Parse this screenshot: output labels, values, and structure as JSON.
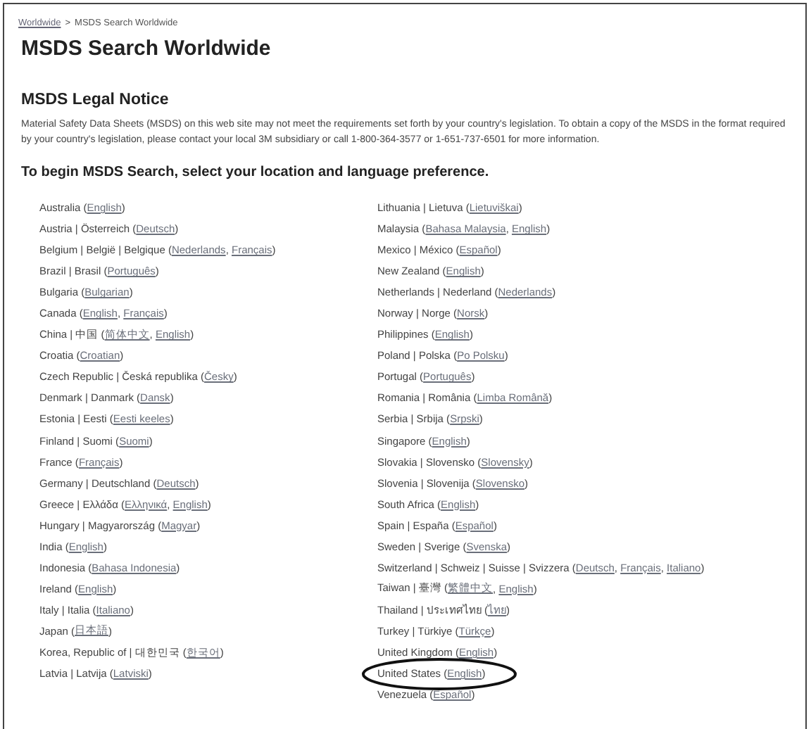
{
  "breadcrumb": {
    "link": "Worldwide",
    "separator": ">",
    "current": "MSDS Search Worldwide"
  },
  "title": "MSDS Search Worldwide",
  "notice": {
    "heading": "MSDS Legal Notice",
    "text": "Material Safety Data Sheets (MSDS) on this web site may not meet the requirements set forth by your country's legislation. To obtain a copy of the MSDS in the format required by your country's legislation, please contact your local 3M subsidiary or call 1-800-364-3577 or 1-651-737-6501 for more information."
  },
  "prompt": "To begin MSDS Search, select your location and language preference.",
  "columns": [
    [
      {
        "highlighted": false,
        "parts": [
          {
            "text": "Australia ("
          },
          {
            "link": "English"
          },
          {
            "text": ")"
          }
        ]
      },
      {
        "highlighted": false,
        "parts": [
          {
            "text": "Austria | Österreich ("
          },
          {
            "link": "Deutsch"
          },
          {
            "text": ")"
          }
        ]
      },
      {
        "highlighted": false,
        "parts": [
          {
            "text": "Belgium | België | Belgique ("
          },
          {
            "link": "Nederlands"
          },
          {
            "text": ", "
          },
          {
            "link": "Français"
          },
          {
            "text": ")"
          }
        ]
      },
      {
        "highlighted": false,
        "parts": [
          {
            "text": "Brazil | Brasil ("
          },
          {
            "link": "Português"
          },
          {
            "text": ")"
          }
        ]
      },
      {
        "highlighted": false,
        "parts": [
          {
            "text": "Bulgaria ("
          },
          {
            "link": "Bulgarian"
          },
          {
            "text": ")"
          }
        ]
      },
      {
        "highlighted": false,
        "parts": [
          {
            "text": "Canada ("
          },
          {
            "link": "English"
          },
          {
            "text": ", "
          },
          {
            "link": "Français"
          },
          {
            "text": ")"
          }
        ]
      },
      {
        "highlighted": false,
        "parts": [
          {
            "text": "China | 中国 ("
          },
          {
            "link": "简体中文"
          },
          {
            "text": ", "
          },
          {
            "link": "English"
          },
          {
            "text": ")"
          }
        ]
      },
      {
        "highlighted": false,
        "parts": [
          {
            "text": "Croatia ("
          },
          {
            "link": "Croatian"
          },
          {
            "text": ")"
          }
        ]
      },
      {
        "highlighted": false,
        "parts": [
          {
            "text": "Czech Republic | Česká republika ("
          },
          {
            "link": "Česky"
          },
          {
            "text": ")"
          }
        ]
      },
      {
        "highlighted": false,
        "parts": [
          {
            "text": "Denmark | Danmark ("
          },
          {
            "link": "Dansk"
          },
          {
            "text": ")"
          }
        ]
      },
      {
        "highlighted": false,
        "parts": [
          {
            "text": "Estonia | Eesti ("
          },
          {
            "link": "Eesti keeles"
          },
          {
            "text": ")"
          }
        ]
      },
      {
        "highlighted": false,
        "parts": [
          {
            "text": "Finland | Suomi ("
          },
          {
            "link": "Suomi"
          },
          {
            "text": ")"
          }
        ]
      },
      {
        "highlighted": false,
        "parts": [
          {
            "text": "France ("
          },
          {
            "link": "Français"
          },
          {
            "text": ")"
          }
        ]
      },
      {
        "highlighted": false,
        "parts": [
          {
            "text": "Germany | Deutschland ("
          },
          {
            "link": "Deutsch"
          },
          {
            "text": ")"
          }
        ]
      },
      {
        "highlighted": false,
        "parts": [
          {
            "text": "Greece | Ελλάδα ("
          },
          {
            "link": "Ελληνικά"
          },
          {
            "text": ", "
          },
          {
            "link": "English"
          },
          {
            "text": ")"
          }
        ]
      },
      {
        "highlighted": false,
        "parts": [
          {
            "text": "Hungary | Magyarország ("
          },
          {
            "link": "Magyar"
          },
          {
            "text": ")"
          }
        ]
      },
      {
        "highlighted": false,
        "parts": [
          {
            "text": "India ("
          },
          {
            "link": "English"
          },
          {
            "text": ")"
          }
        ]
      },
      {
        "highlighted": false,
        "parts": [
          {
            "text": "Indonesia ("
          },
          {
            "link": "Bahasa Indonesia"
          },
          {
            "text": ")"
          }
        ]
      },
      {
        "highlighted": false,
        "parts": [
          {
            "text": "Ireland ("
          },
          {
            "link": "English"
          },
          {
            "text": ")"
          }
        ]
      },
      {
        "highlighted": false,
        "parts": [
          {
            "text": "Italy | Italia ("
          },
          {
            "link": "Italiano"
          },
          {
            "text": ")"
          }
        ]
      },
      {
        "highlighted": false,
        "parts": [
          {
            "text": "Japan ("
          },
          {
            "link": "日本語"
          },
          {
            "text": ")"
          }
        ]
      },
      {
        "highlighted": false,
        "parts": [
          {
            "text": "Korea, Republic of | 대한민국 ("
          },
          {
            "link": "한국어"
          },
          {
            "text": ")"
          }
        ]
      },
      {
        "highlighted": false,
        "parts": [
          {
            "text": "Latvia | Latvija ("
          },
          {
            "link": "Latviski"
          },
          {
            "text": ")"
          }
        ]
      }
    ],
    [
      {
        "highlighted": false,
        "parts": [
          {
            "text": "Lithuania | Lietuva ("
          },
          {
            "link": "Lietuviškai"
          },
          {
            "text": ")"
          }
        ]
      },
      {
        "highlighted": false,
        "parts": [
          {
            "text": "Malaysia ("
          },
          {
            "link": "Bahasa Malaysia"
          },
          {
            "text": ", "
          },
          {
            "link": "English"
          },
          {
            "text": ")"
          }
        ]
      },
      {
        "highlighted": false,
        "parts": [
          {
            "text": "Mexico | México ("
          },
          {
            "link": "Español"
          },
          {
            "text": ")"
          }
        ]
      },
      {
        "highlighted": false,
        "parts": [
          {
            "text": "New Zealand ("
          },
          {
            "link": "English"
          },
          {
            "text": ")"
          }
        ]
      },
      {
        "highlighted": false,
        "parts": [
          {
            "text": "Netherlands | Nederland ("
          },
          {
            "link": "Nederlands"
          },
          {
            "text": ")"
          }
        ]
      },
      {
        "highlighted": false,
        "parts": [
          {
            "text": "Norway | Norge ("
          },
          {
            "link": "Norsk"
          },
          {
            "text": ")"
          }
        ]
      },
      {
        "highlighted": false,
        "parts": [
          {
            "text": "Philippines ("
          },
          {
            "link": "English"
          },
          {
            "text": ")"
          }
        ]
      },
      {
        "highlighted": false,
        "parts": [
          {
            "text": "Poland | Polska ("
          },
          {
            "link": "Po Polsku"
          },
          {
            "text": ")"
          }
        ]
      },
      {
        "highlighted": false,
        "parts": [
          {
            "text": "Portugal ("
          },
          {
            "link": "Português"
          },
          {
            "text": ")"
          }
        ]
      },
      {
        "highlighted": false,
        "parts": [
          {
            "text": "Romania | România ("
          },
          {
            "link": "Limba Română"
          },
          {
            "text": ")"
          }
        ]
      },
      {
        "highlighted": false,
        "parts": [
          {
            "text": "Serbia | Srbija ("
          },
          {
            "link": "Srpski"
          },
          {
            "text": ")"
          }
        ]
      },
      {
        "highlighted": false,
        "parts": [
          {
            "text": "Singapore ("
          },
          {
            "link": "English"
          },
          {
            "text": ")"
          }
        ]
      },
      {
        "highlighted": false,
        "parts": [
          {
            "text": "Slovakia | Slovensko ("
          },
          {
            "link": "Slovensky"
          },
          {
            "text": ")"
          }
        ]
      },
      {
        "highlighted": false,
        "parts": [
          {
            "text": "Slovenia | Slovenija ("
          },
          {
            "link": "Slovensko"
          },
          {
            "text": ")"
          }
        ]
      },
      {
        "highlighted": false,
        "parts": [
          {
            "text": "South Africa ("
          },
          {
            "link": "English"
          },
          {
            "text": ")"
          }
        ]
      },
      {
        "highlighted": false,
        "parts": [
          {
            "text": "Spain | España ("
          },
          {
            "link": "Español"
          },
          {
            "text": ")"
          }
        ]
      },
      {
        "highlighted": false,
        "parts": [
          {
            "text": "Sweden | Sverige ("
          },
          {
            "link": "Svenska"
          },
          {
            "text": ")"
          }
        ]
      },
      {
        "highlighted": false,
        "parts": [
          {
            "text": "Switzerland | Schweiz | Suisse | Svizzera ("
          },
          {
            "link": "Deutsch"
          },
          {
            "text": ", "
          },
          {
            "link": "Français"
          },
          {
            "text": ", "
          },
          {
            "link": "Italiano"
          },
          {
            "text": ")"
          }
        ]
      },
      {
        "highlighted": false,
        "parts": [
          {
            "text": "Taiwan | 臺灣 ("
          },
          {
            "link": "繁體中文"
          },
          {
            "text": ", "
          },
          {
            "link": "English"
          },
          {
            "text": ")"
          }
        ]
      },
      {
        "highlighted": false,
        "parts": [
          {
            "text": "Thailand | ประเทศไทย ("
          },
          {
            "link": "ไทย"
          },
          {
            "text": ")"
          }
        ]
      },
      {
        "highlighted": false,
        "parts": [
          {
            "text": "Turkey | Türkiye ("
          },
          {
            "link": "Türkçe"
          },
          {
            "text": ")"
          }
        ]
      },
      {
        "highlighted": false,
        "parts": [
          {
            "text": "United Kingdom ("
          },
          {
            "link": "English"
          },
          {
            "text": ")"
          }
        ]
      },
      {
        "highlighted": true,
        "parts": [
          {
            "text": "United States ("
          },
          {
            "link": "English"
          },
          {
            "text": ")"
          }
        ]
      },
      {
        "highlighted": false,
        "parts": [
          {
            "text": "Venezuela ("
          },
          {
            "link": "Español"
          },
          {
            "text": ")"
          }
        ]
      }
    ]
  ]
}
